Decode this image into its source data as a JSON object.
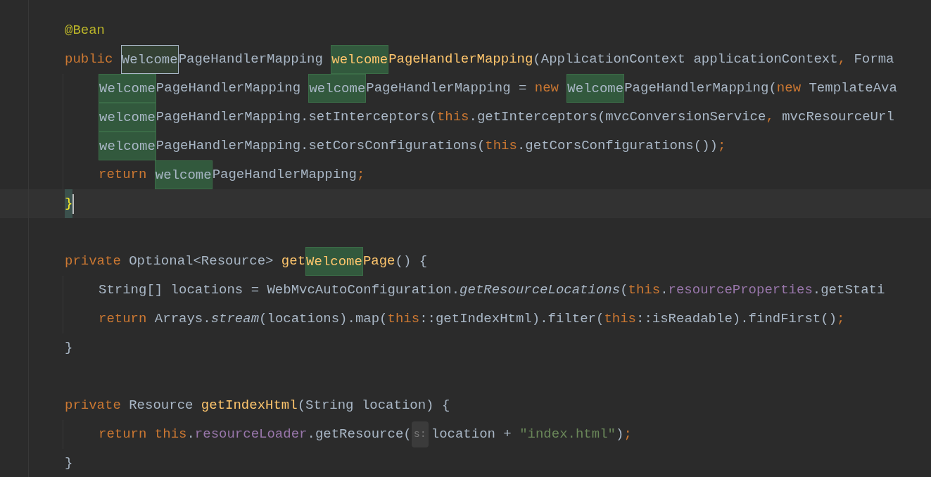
{
  "editor": {
    "lines": [
      {
        "kind": "code",
        "current": false,
        "tokens": [
          {
            "text": "@Bean",
            "kind": "annotation"
          }
        ]
      },
      {
        "kind": "code",
        "current": false,
        "tokens": [
          {
            "text": "public ",
            "kind": "keyword"
          },
          {
            "text": "Welcome",
            "kind": "caret_occurrence"
          },
          {
            "text": "PageHandlerMapping ",
            "kind": "plain"
          },
          {
            "text": "welcome",
            "kind": "method_occurrence"
          },
          {
            "text": "PageHandlerMapping",
            "kind": "method"
          },
          {
            "text": "(ApplicationContext applicationContext",
            "kind": "plain"
          },
          {
            "text": ", ",
            "kind": "keyword"
          },
          {
            "text": "Forma",
            "kind": "plain"
          }
        ],
        "children": [
          {
            "kind": "code",
            "current": false,
            "tokens": [
              {
                "text": "Welcome",
                "kind": "occurrence"
              },
              {
                "text": "PageHandlerMapping ",
                "kind": "plain"
              },
              {
                "text": "welcome",
                "kind": "occurrence"
              },
              {
                "text": "PageHandlerMapping = ",
                "kind": "plain"
              },
              {
                "text": "new ",
                "kind": "keyword"
              },
              {
                "text": "Welcome",
                "kind": "occurrence"
              },
              {
                "text": "PageHandlerMapping(",
                "kind": "plain"
              },
              {
                "text": "new ",
                "kind": "keyword"
              },
              {
                "text": "TemplateAva",
                "kind": "plain"
              }
            ]
          },
          {
            "kind": "code",
            "current": false,
            "tokens": [
              {
                "text": "welcome",
                "kind": "occurrence"
              },
              {
                "text": "PageHandlerMapping.setInterceptors(",
                "kind": "plain"
              },
              {
                "text": "this",
                "kind": "keyword"
              },
              {
                "text": ".getInterceptors(mvcConversionService",
                "kind": "plain"
              },
              {
                "text": ", ",
                "kind": "keyword"
              },
              {
                "text": "mvcResourceUrl",
                "kind": "plain"
              }
            ]
          },
          {
            "kind": "code",
            "current": false,
            "tokens": [
              {
                "text": "welcome",
                "kind": "occurrence"
              },
              {
                "text": "PageHandlerMapping.setCorsConfigurations(",
                "kind": "plain"
              },
              {
                "text": "this",
                "kind": "keyword"
              },
              {
                "text": ".getCorsConfigurations())",
                "kind": "plain"
              },
              {
                "text": ";",
                "kind": "keyword"
              }
            ]
          },
          {
            "kind": "code",
            "current": false,
            "tokens": [
              {
                "text": "return ",
                "kind": "keyword"
              },
              {
                "text": "welcome",
                "kind": "occurrence"
              },
              {
                "text": "PageHandlerMapping",
                "kind": "plain"
              },
              {
                "text": ";",
                "kind": "keyword"
              }
            ]
          }
        ]
      },
      {
        "kind": "code",
        "current": true,
        "tokens": [
          {
            "text": "}",
            "kind": "matched_brace"
          }
        ]
      },
      {
        "kind": "blank"
      },
      {
        "kind": "code",
        "current": false,
        "tokens": [
          {
            "text": "private ",
            "kind": "keyword"
          },
          {
            "text": "Optional<Resource> ",
            "kind": "plain"
          },
          {
            "text": "get",
            "kind": "method"
          },
          {
            "text": "Welcome",
            "kind": "method_occurrence"
          },
          {
            "text": "Page",
            "kind": "method"
          },
          {
            "text": "() {",
            "kind": "plain"
          }
        ],
        "children": [
          {
            "kind": "code",
            "current": false,
            "tokens": [
              {
                "text": "String[] locations = WebMvcAutoConfiguration.",
                "kind": "plain"
              },
              {
                "text": "getResourceLocations",
                "kind": "static"
              },
              {
                "text": "(",
                "kind": "plain"
              },
              {
                "text": "this",
                "kind": "keyword"
              },
              {
                "text": ".",
                "kind": "plain"
              },
              {
                "text": "resourceProperties",
                "kind": "field"
              },
              {
                "text": ".getStati",
                "kind": "plain"
              }
            ]
          },
          {
            "kind": "code",
            "current": false,
            "tokens": [
              {
                "text": "return ",
                "kind": "keyword"
              },
              {
                "text": "Arrays.",
                "kind": "plain"
              },
              {
                "text": "stream",
                "kind": "static"
              },
              {
                "text": "(locations).map(",
                "kind": "plain"
              },
              {
                "text": "this",
                "kind": "keyword"
              },
              {
                "text": "::getIndexHtml).filter(",
                "kind": "plain"
              },
              {
                "text": "this",
                "kind": "keyword"
              },
              {
                "text": "::isReadable).findFirst()",
                "kind": "plain"
              },
              {
                "text": ";",
                "kind": "keyword"
              }
            ]
          }
        ]
      },
      {
        "kind": "code",
        "current": false,
        "tokens": [
          {
            "text": "}",
            "kind": "plain"
          }
        ]
      },
      {
        "kind": "blank"
      },
      {
        "kind": "code",
        "current": false,
        "tokens": [
          {
            "text": "private ",
            "kind": "keyword"
          },
          {
            "text": "Resource ",
            "kind": "plain"
          },
          {
            "text": "getIndexHtml",
            "kind": "method"
          },
          {
            "text": "(String location) {",
            "kind": "plain"
          }
        ],
        "children": [
          {
            "kind": "code",
            "current": false,
            "tokens": [
              {
                "text": "return ",
                "kind": "keyword"
              },
              {
                "text": "this",
                "kind": "keyword"
              },
              {
                "text": ".",
                "kind": "plain"
              },
              {
                "text": "resourceLoader",
                "kind": "field"
              },
              {
                "text": ".getResource(",
                "kind": "plain"
              },
              {
                "text": "s:",
                "kind": "hint"
              },
              {
                "text": "location + ",
                "kind": "plain"
              },
              {
                "text": "\"index.html\"",
                "kind": "string"
              },
              {
                "text": ")",
                "kind": "plain"
              },
              {
                "text": ";",
                "kind": "keyword"
              }
            ]
          }
        ]
      },
      {
        "kind": "code",
        "current": false,
        "tokens": [
          {
            "text": "}",
            "kind": "plain"
          }
        ]
      }
    ]
  }
}
